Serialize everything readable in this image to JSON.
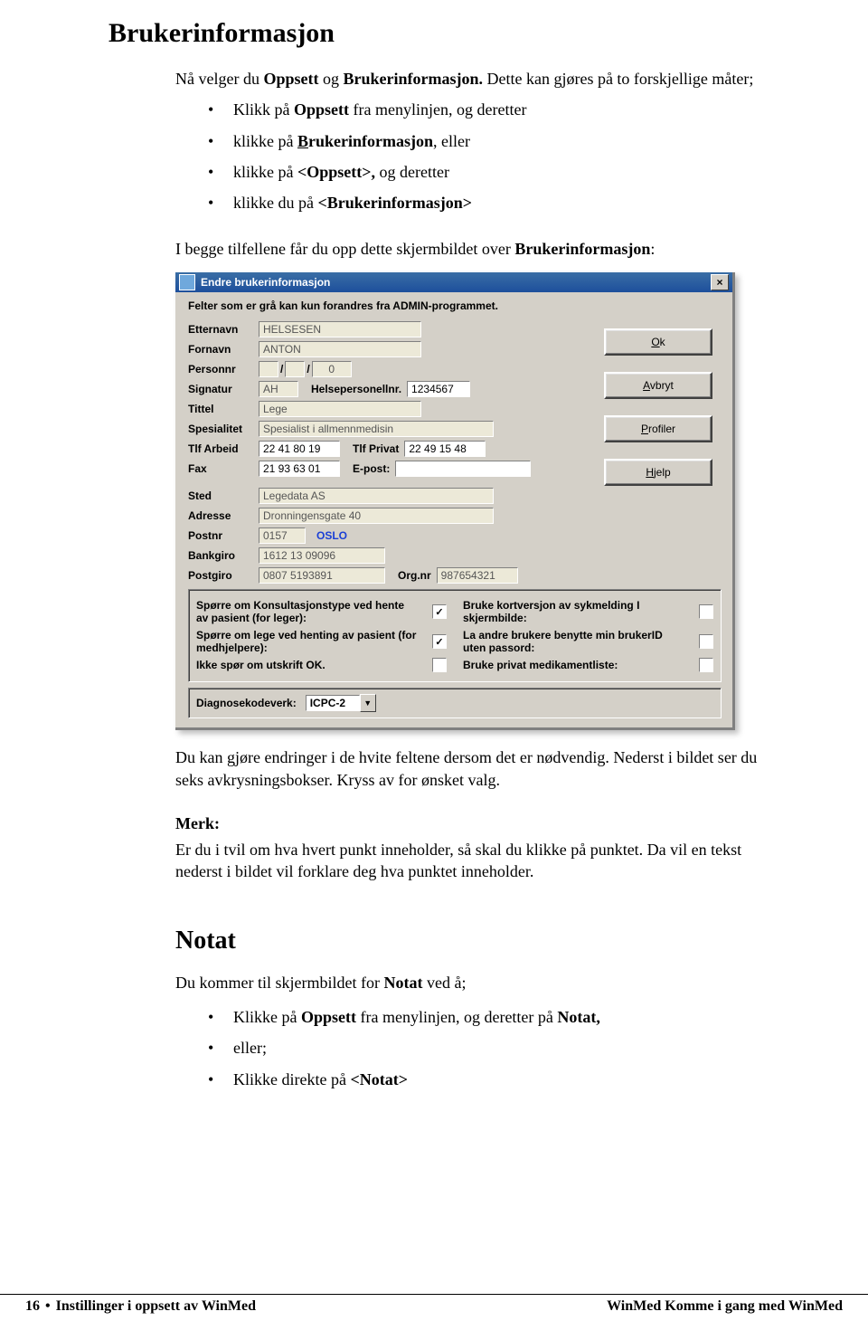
{
  "heading": "Brukerinformasjon",
  "intro_pre": "Nå velger du ",
  "intro_b1": "Oppsett",
  "intro_mid": " og ",
  "intro_b2": "Brukerinformasjon.",
  "intro_post": " Dette kan gjøres på to forskjellige måter;",
  "bullets1": {
    "b1_pre": "Klikk på ",
    "b1_b": "Oppsett",
    "b1_post": " fra menylinjen, og deretter",
    "b2_pre": "klikke på ",
    "b2_u": "B",
    "b2_b": "rukerinformasjon",
    "b2_post": ", eller",
    "b3_pre": "klikke på ",
    "b3_b": "<Oppsett>,",
    "b3_post": " og deretter",
    "b4_pre": "klikke du på ",
    "b4_b": "<Brukerinformasjon>"
  },
  "para_cases_pre": "I begge tilfellene får du opp dette skjermbildet over ",
  "para_cases_b": "Brukerinformasjon",
  "para_cases_post": ":",
  "shot": {
    "title": "Endre brukerinformasjon",
    "hint": "Felter som er grå kan kun forandres fra ADMIN-programmet.",
    "labels": {
      "etternavn": "Etternavn",
      "fornavn": "Fornavn",
      "personnr": "Personnr",
      "signatur": "Signatur",
      "hpnr": "Helsepersonellnr.",
      "tittel": "Tittel",
      "spesialitet": "Spesialitet",
      "tlfarbeid": "Tlf Arbeid",
      "tlfprivat": "Tlf Privat",
      "fax": "Fax",
      "epost": "E-post:",
      "sted": "Sted",
      "adresse": "Adresse",
      "postnr": "Postnr",
      "bankgiro": "Bankgiro",
      "postgiro": "Postgiro",
      "orgnr": "Org.nr"
    },
    "values": {
      "etternavn": "HELSESEN",
      "fornavn": "ANTON",
      "personnr_d": "",
      "personnr_m": "",
      "personnr_last": "0",
      "signatur": "AH",
      "hpnr": "1234567",
      "tittel": "Lege",
      "spesialitet": "Spesialist i allmennmedisin",
      "tlfarbeid": "22 41 80 19",
      "tlfprivat": "22 49 15 48",
      "fax": "21 93 63 01",
      "epost": "",
      "sted": "Legedata AS",
      "adresse": "Dronningensgate 40",
      "postnr": "0157",
      "poststed": "OSLO",
      "bankgiro": "1612 13 09096",
      "postgiro": "0807 5193891",
      "orgnr": "987654321"
    },
    "buttons": {
      "ok": "Ok",
      "avbryt": "Avbryt",
      "profiler": "Profiler",
      "hjelp": "Hjelp"
    },
    "options": {
      "o1": "Spørre om Konsultasjonstype ved hente av pasient (for leger):",
      "o2": "Bruke kortversjon av sykmelding I skjermbilde:",
      "o3": "Spørre om lege ved henting av pasient (for medhjelpere):",
      "o4": "La andre brukere benytte min brukerID uten passord:",
      "o5": "Ikke spør om utskrift OK.",
      "o6": "Bruke privat medikamentliste:",
      "diag_lbl": "Diagnosekodeverk:",
      "diag_val": "ICPC-2"
    },
    "checks": {
      "o1": "✓",
      "o2": "",
      "o3": "✓",
      "o4": "",
      "o5": "",
      "o6": ""
    }
  },
  "after_shot": "Du kan gjøre endringer i de hvite feltene dersom det er nødvendig. Nederst i bildet ser du seks avkrysningsbokser. Kryss av for ønsket valg.",
  "merk_h": "Merk:",
  "merk_p": "Er du i tvil om hva hvert punkt inneholder, så skal du klikke på punktet. Da vil en tekst nederst i bildet vil forklare deg hva punktet inneholder.",
  "notat_h": "Notat",
  "notat_intro_pre": "Du kommer til skjermbildet for ",
  "notat_intro_b": "Notat",
  "notat_intro_post": " ved å;",
  "bullets2": {
    "b1_pre": "Klikke på ",
    "b1_b": "Oppsett",
    "b1_mid": " fra menylinjen, og deretter på ",
    "b1_b2": "Notat,",
    "b2": "eller;",
    "b3_pre": "Klikke direkte på ",
    "b3_b": "<Notat>"
  },
  "footer": {
    "page": "16",
    "left": "Instillinger i oppsett av WinMed",
    "right": "WinMed   Komme i gang med WinMed"
  }
}
